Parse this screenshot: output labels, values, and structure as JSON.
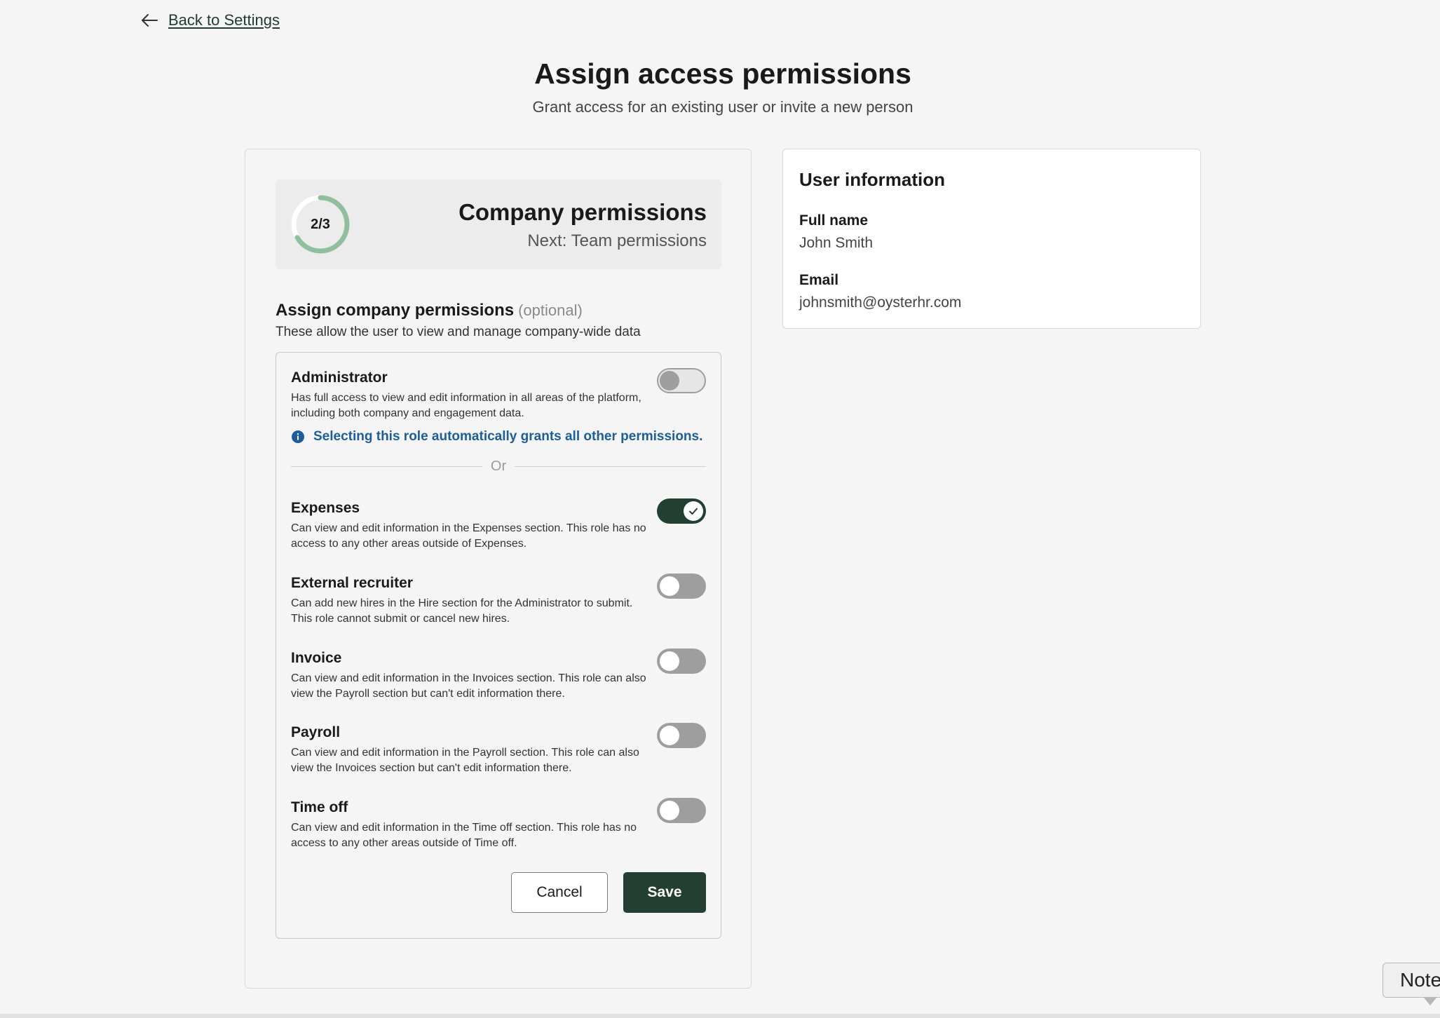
{
  "nav": {
    "back_label": "Back to Settings",
    "back_icon": "arrow-left-icon"
  },
  "header": {
    "title": "Assign access permissions",
    "subtitle": "Grant access for an existing user or invite a new person"
  },
  "step": {
    "progress_label": "2/3",
    "current": 2,
    "total": 3,
    "title": "Company permissions",
    "next": "Next: Team permissions",
    "ring_color": "#8fbf9f"
  },
  "section": {
    "title": "Assign company permissions",
    "optional": "(optional)",
    "description": "These allow the user to view and manage company-wide data"
  },
  "administrator": {
    "name": "Administrator",
    "description": "Has full access to view and edit information in all areas of the platform, including both company and engagement data.",
    "enabled": false,
    "info_icon": "info-icon",
    "info_text": "Selecting this role automatically grants all other permissions.",
    "divider_text": "Or"
  },
  "permissions": [
    {
      "name": "Expenses",
      "description": "Can view and edit information in the Expenses section. This role has no access to any other areas outside of Expenses.",
      "enabled": true
    },
    {
      "name": "External recruiter",
      "description": "Can add new hires in the Hire section for the Administrator to submit. This role cannot submit or cancel new hires.",
      "enabled": false
    },
    {
      "name": "Invoice",
      "description": "Can view and edit information in the Invoices section. This role can also view the Payroll section but can't edit information there.",
      "enabled": false
    },
    {
      "name": "Payroll",
      "description": "Can view and edit information in the Payroll section. This role can also view the Invoices section but can't edit information there.",
      "enabled": false
    },
    {
      "name": "Time off",
      "description": "Can view and edit information in the Time off section. This role has no access to any other areas outside of Time off.",
      "enabled": false
    }
  ],
  "actions": {
    "cancel_label": "Cancel",
    "save_label": "Save"
  },
  "user_info": {
    "title": "User information",
    "full_name_label": "Full name",
    "full_name": "John Smith",
    "email_label": "Email",
    "email": "johnsmith@oysterhr.com"
  },
  "notes_tab": {
    "label": "Note"
  },
  "colors": {
    "brand_dark": "#233f31",
    "info_blue": "#1d5d9b",
    "ring_green": "#8fbf9f"
  }
}
